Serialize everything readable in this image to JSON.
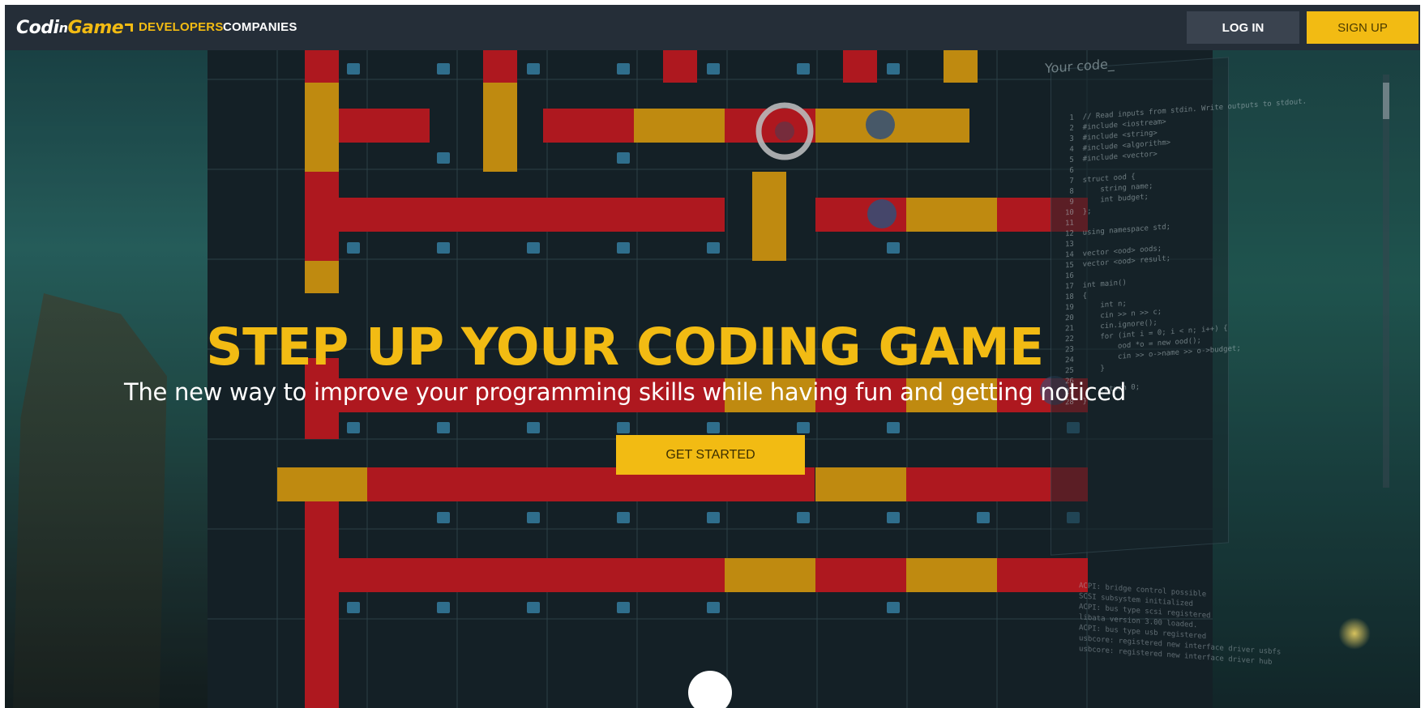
{
  "nav": {
    "logo_part1": "Codi",
    "logo_part2": "Game",
    "developers": "DEVELOPERS",
    "companies": "COMPANIES",
    "login": "LOG IN",
    "signup": "SIGN UP"
  },
  "hero": {
    "headline": "STEP UP YOUR CODING GAME",
    "subline": "The new way to improve your programming skills while having fun and getting noticed",
    "cta": "GET STARTED"
  },
  "code_panel": {
    "title": "Your code_",
    "lines": " 1  // Read inputs from stdin. Write outputs to stdout.\n 2  #include <iostream>\n 3  #include <string>\n 4  #include <algorithm>\n 5  #include <vector>\n 6\n 7  struct ood {\n 8      string name;\n 9      int budget;\n10  };\n11\n12  using namespace std;\n13\n14  vector <ood> oods;\n15  vector <ood> result;\n16\n17  int main()\n18  {\n19      int n;\n20      cin >> n >> c;\n21      cin.ignore();\n22      for (int i = 0; i < n; i++) {\n23          ood *o = new ood();\n24          cin >> o->name >> o->budget;\n25      }\n26\n27      return 0;\n28  }",
    "console": "ACPI: bridge control possible\nSCSI subsystem initialized\nACPI: bus type scsi registered\nlibata version 3.00 loaded.\nACPI: bus type usb registered\nusbcore: registered new interface driver usbfs\nusbcore: registered new interface driver hub"
  },
  "colors": {
    "accent": "#f2bb13",
    "navbar": "#252e38",
    "login_bg": "#3a434f",
    "track_red": "#cc1a22",
    "track_gold": "#e0a010"
  }
}
